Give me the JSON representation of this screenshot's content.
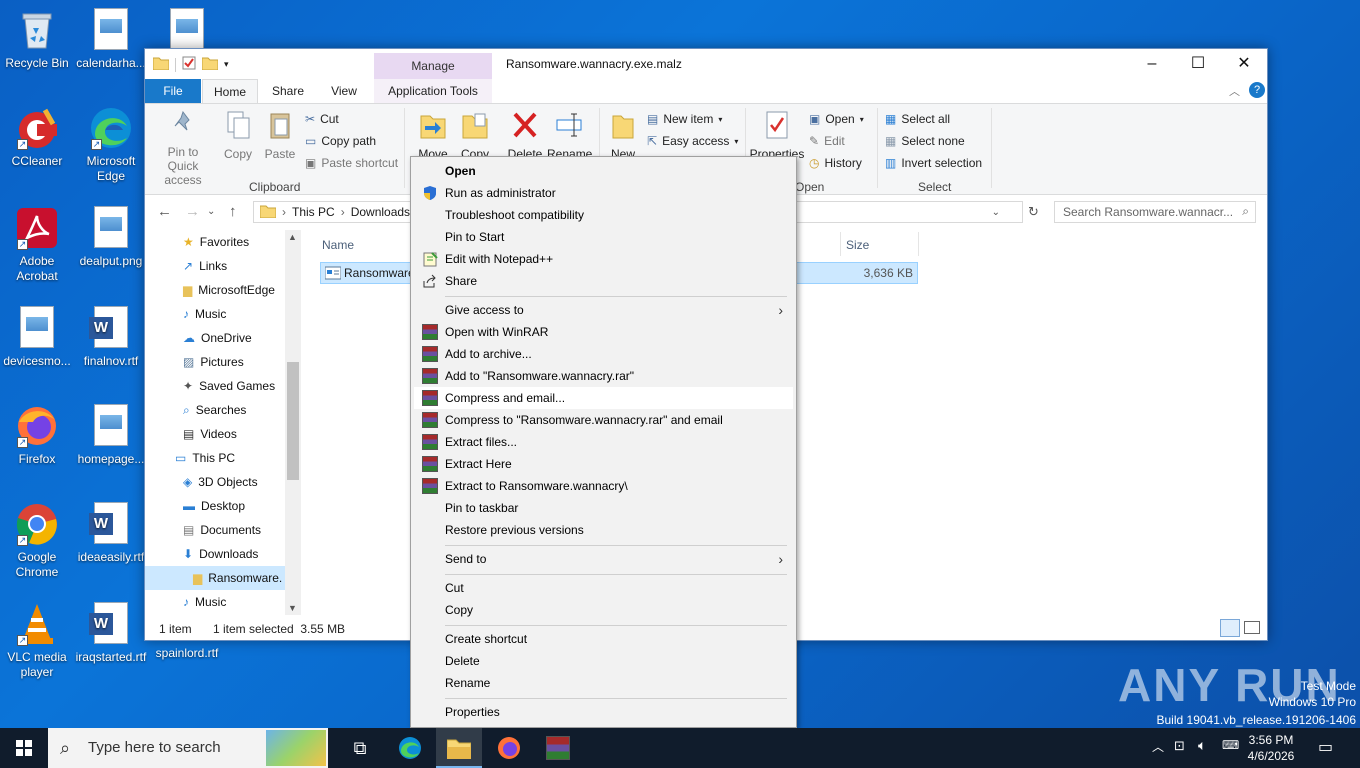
{
  "desktop": {
    "icons": [
      {
        "label": "Recycle Bin",
        "icon": "recycle-bin-icon"
      },
      {
        "label": "calendarha...",
        "icon": "image-file-icon"
      },
      {
        "label": "CCleaner",
        "icon": "ccleaner-icon"
      },
      {
        "label": "Microsoft Edge",
        "icon": "edge-icon"
      },
      {
        "label": "Adobe Acrobat",
        "icon": "acrobat-icon"
      },
      {
        "label": "dealput.png",
        "icon": "image-file-icon"
      },
      {
        "label": "devicesmo...",
        "icon": "image-file-icon"
      },
      {
        "label": "finalnov.rtf",
        "icon": "word-doc-icon"
      },
      {
        "label": "Firefox",
        "icon": "firefox-icon"
      },
      {
        "label": "homepage...",
        "icon": "image-file-icon"
      },
      {
        "label": "Google Chrome",
        "icon": "chrome-icon"
      },
      {
        "label": "ideaeasily.rtf",
        "icon": "word-doc-icon"
      },
      {
        "label": "VLC media player",
        "icon": "vlc-icon"
      },
      {
        "label": "iraqstarted.rtf",
        "icon": "word-doc-icon"
      },
      {
        "label": "spainlord.rtf",
        "icon": "image-file-icon"
      }
    ]
  },
  "window": {
    "title": "Ransomware.wannacry.exe.malz",
    "manage_tab": "Manage",
    "tabs": {
      "file": "File",
      "home": "Home",
      "share": "Share",
      "view": "View",
      "app_tools": "Application Tools"
    },
    "ribbon": {
      "pin": "Pin to Quick access",
      "copy": "Copy",
      "paste": "Paste",
      "cut": "Cut",
      "copy_path": "Copy path",
      "paste_shortcut": "Paste shortcut",
      "clipboard": "Clipboard",
      "move": "Move",
      "copy_to": "Copy",
      "delete": "Delete",
      "rename": "Rename",
      "new": "New",
      "new_item": "New item",
      "easy_access": "Easy access",
      "properties": "Properties",
      "open": "Open",
      "edit": "Edit",
      "history": "History",
      "open_group": "Open",
      "select_all": "Select all",
      "select_none": "Select none",
      "invert_selection": "Invert selection",
      "select_group": "Select"
    },
    "address": {
      "this_pc": "This PC",
      "downloads": "Downloads",
      "search_placeholder": "Search Ransomware.wannacr..."
    },
    "nav_items": [
      {
        "label": "Favorites"
      },
      {
        "label": "Links"
      },
      {
        "label": "MicrosoftEdge"
      },
      {
        "label": "Music"
      },
      {
        "label": "OneDrive"
      },
      {
        "label": "Pictures"
      },
      {
        "label": "Saved Games"
      },
      {
        "label": "Searches"
      },
      {
        "label": "Videos"
      },
      {
        "label": "This PC"
      },
      {
        "label": "3D Objects"
      },
      {
        "label": "Desktop"
      },
      {
        "label": "Documents"
      },
      {
        "label": "Downloads"
      },
      {
        "label": "Ransomware."
      },
      {
        "label": "Music"
      }
    ],
    "columns": {
      "name": "Name",
      "size": "Size"
    },
    "file": {
      "name": "Ransomware",
      "size": "3,636 KB"
    },
    "status": {
      "count": "1 item",
      "selected": "1 item selected  3.55 MB"
    }
  },
  "context_menu": {
    "items": [
      {
        "label": "Open"
      },
      {
        "label": "Run as administrator"
      },
      {
        "label": "Troubleshoot compatibility"
      },
      {
        "label": "Pin to Start"
      },
      {
        "label": "Edit with Notepad++"
      },
      {
        "label": "Share"
      },
      {
        "label": "Give access to"
      },
      {
        "label": "Open with WinRAR"
      },
      {
        "label": "Add to archive..."
      },
      {
        "label": "Add to \"Ransomware.wannacry.rar\""
      },
      {
        "label": "Compress and email..."
      },
      {
        "label": "Compress to \"Ransomware.wannacry.rar\" and email"
      },
      {
        "label": "Extract files..."
      },
      {
        "label": "Extract Here"
      },
      {
        "label": "Extract to Ransomware.wannacry\\"
      },
      {
        "label": "Pin to taskbar"
      },
      {
        "label": "Restore previous versions"
      },
      {
        "label": "Send to"
      },
      {
        "label": "Cut"
      },
      {
        "label": "Copy"
      },
      {
        "label": "Create shortcut"
      },
      {
        "label": "Delete"
      },
      {
        "label": "Rename"
      },
      {
        "label": "Properties"
      }
    ]
  },
  "taskbar": {
    "search_placeholder": "Type here to search",
    "time": "3:56 PM",
    "date": "4/6/2026"
  },
  "watermark": {
    "line1": "Test Mode",
    "line2": "Windows 10 Pro",
    "line3": "Build 19041.vb_release.191206-1406",
    "brand": "ANY RUN"
  },
  "colors": {
    "accent": "#1979ca",
    "selection": "#cce8ff",
    "manage": "#e8d9f2"
  }
}
